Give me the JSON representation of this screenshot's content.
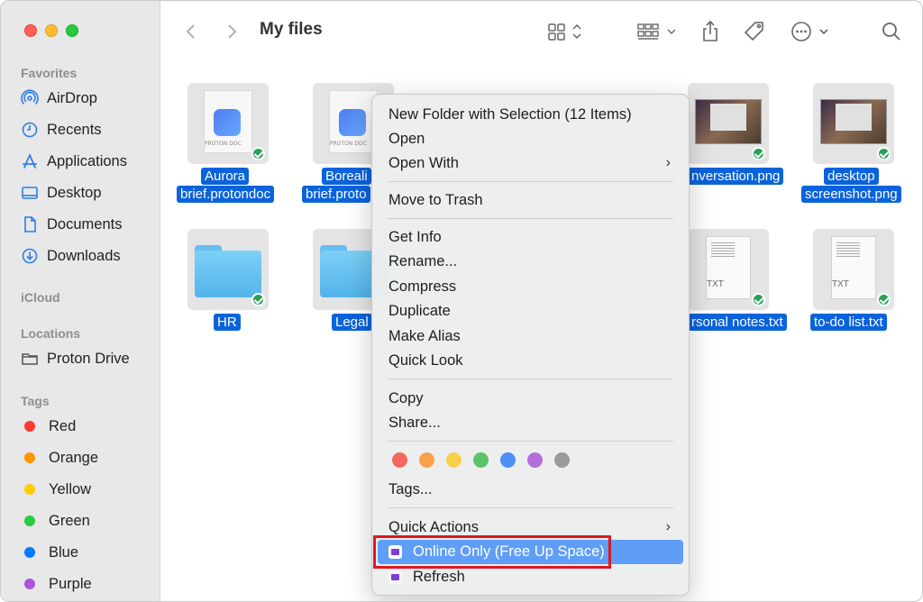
{
  "sidebar": {
    "sections": {
      "favorites": "Favorites",
      "icloud": "iCloud",
      "locations": "Locations",
      "tags": "Tags"
    },
    "favorites": [
      {
        "label": "AirDrop",
        "icon": "airdrop-icon"
      },
      {
        "label": "Recents",
        "icon": "clock-icon"
      },
      {
        "label": "Applications",
        "icon": "applications-icon"
      },
      {
        "label": "Desktop",
        "icon": "desktop-icon"
      },
      {
        "label": "Documents",
        "icon": "document-icon"
      },
      {
        "label": "Downloads",
        "icon": "download-icon"
      }
    ],
    "locations": [
      {
        "label": "Proton Drive",
        "icon": "folder-icon"
      }
    ],
    "tags": [
      {
        "label": "Red",
        "color": "#fe3b30"
      },
      {
        "label": "Orange",
        "color": "#ff9500"
      },
      {
        "label": "Yellow",
        "color": "#ffcc00"
      },
      {
        "label": "Green",
        "color": "#28cd41"
      },
      {
        "label": "Blue",
        "color": "#007aff"
      },
      {
        "label": "Purple",
        "color": "#af52de"
      }
    ]
  },
  "toolbar": {
    "title": "My files"
  },
  "files": [
    {
      "name_line1": "Aurora",
      "name_line2": "brief.protondoc",
      "doc_label": "PROTON DOC"
    },
    {
      "name_line1": "Boreali",
      "name_line2": "brief.proto",
      "doc_label": "PROTON DOC"
    },
    {
      "name_line1": "nversation.png"
    },
    {
      "name_line1": "desktop",
      "name_line2": "screenshot.png"
    },
    {
      "name_line1": "HR"
    },
    {
      "name_line1": "Legal"
    },
    {
      "name_line1": "rsonal notes.txt",
      "doc_label": "TXT"
    },
    {
      "name_line1": "to-do list.txt",
      "doc_label": "TXT"
    }
  ],
  "menu": {
    "new_folder": "New Folder with Selection (12 Items)",
    "open": "Open",
    "open_with": "Open With",
    "move_to_trash": "Move to Trash",
    "get_info": "Get Info",
    "rename": "Rename...",
    "compress": "Compress",
    "duplicate": "Duplicate",
    "make_alias": "Make Alias",
    "quick_look": "Quick Look",
    "copy": "Copy",
    "share": "Share...",
    "tag_colors": [
      "#f4675d",
      "#f5a24a",
      "#f7d04a",
      "#5bc466",
      "#4c8ff5",
      "#b46edc",
      "#9b9b9b"
    ],
    "tags": "Tags...",
    "quick_actions": "Quick Actions",
    "online_only": "Online Only (Free Up Space)",
    "refresh": "Refresh"
  }
}
